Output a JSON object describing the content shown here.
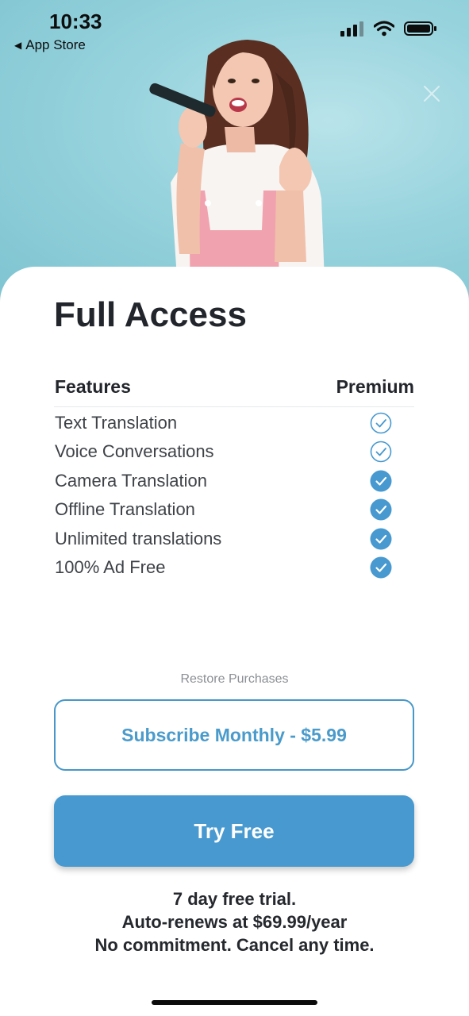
{
  "status_bar": {
    "time": "10:33",
    "back_label": "App Store"
  },
  "title": "Full Access",
  "table": {
    "header_features": "Features",
    "header_plan": "Premium",
    "rows": [
      {
        "label": "Text Translation",
        "check_style": "outline"
      },
      {
        "label": "Voice Conversations",
        "check_style": "outline"
      },
      {
        "label": "Camera Translation",
        "check_style": "filled"
      },
      {
        "label": "Offline Translation",
        "check_style": "filled"
      },
      {
        "label": "Unlimited translations",
        "check_style": "filled"
      },
      {
        "label": "100% Ad Free",
        "check_style": "filled"
      }
    ]
  },
  "restore_label": "Restore Purchases",
  "subscribe_label": "Subscribe Monthly - $5.99",
  "try_label": "Try Free",
  "fine_print": {
    "line1": "7 day free trial.",
    "line2": "Auto-renews at $69.99/year",
    "line3": "No commitment. Cancel any time."
  },
  "colors": {
    "accent": "#4799cf",
    "hero_bg": "#97d3dd",
    "text_dark": "#22252b",
    "muted": "#8b8f94"
  },
  "icons": [
    "back-arrow-icon",
    "signal-icon",
    "wifi-icon",
    "battery-icon",
    "close-icon",
    "checkmark-circle-icon"
  ]
}
